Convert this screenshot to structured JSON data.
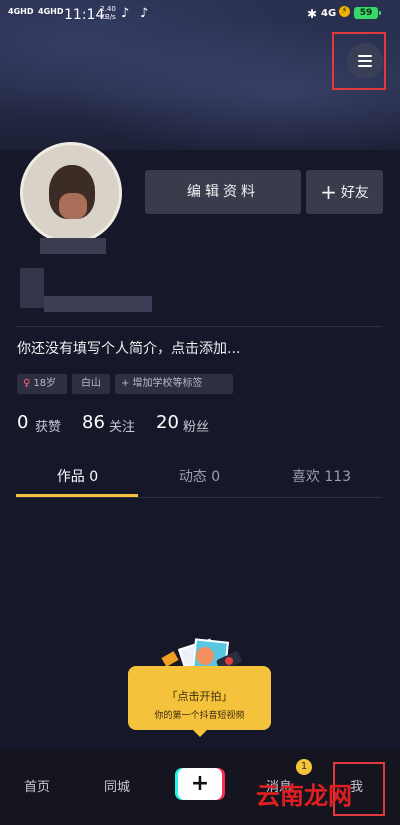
{
  "status_bar": {
    "signal1": "4GHD",
    "signal2": "4GHD",
    "time": "11:14",
    "speed": "2.40 KB/s",
    "app_icon": "tiktok-icon",
    "network": "4G",
    "battery": "59"
  },
  "header": {
    "menu_icon": "hamburger-menu-icon"
  },
  "profile": {
    "edit_button": "编辑资料",
    "add_friend_button": "好友",
    "bio": "你还没有填写个人简介，点击添加...",
    "tags": [
      {
        "label": "18岁",
        "icon": "female-icon"
      },
      {
        "label": "白山"
      },
      {
        "label": "+ 增加学校等标签"
      }
    ]
  },
  "stats": [
    {
      "num": "0",
      "label": "获赞"
    },
    {
      "num": "86",
      "label": "关注"
    },
    {
      "num": "20",
      "label": "粉丝"
    }
  ],
  "tabs": [
    {
      "label": "作品 0"
    },
    {
      "label": "动态 0"
    },
    {
      "label": "喜欢 113"
    }
  ],
  "tooltip": {
    "title": "「点击开拍」",
    "subtitle": "你的第一个抖音短视频"
  },
  "bottom_nav": {
    "home": "首页",
    "city": "同城",
    "plus": "+",
    "messages": "消息",
    "messages_badge": "1",
    "me": "我"
  },
  "watermark": "云南龙网",
  "colors": {
    "accent": "#f5c33b",
    "highlight": "#e23a3a"
  }
}
